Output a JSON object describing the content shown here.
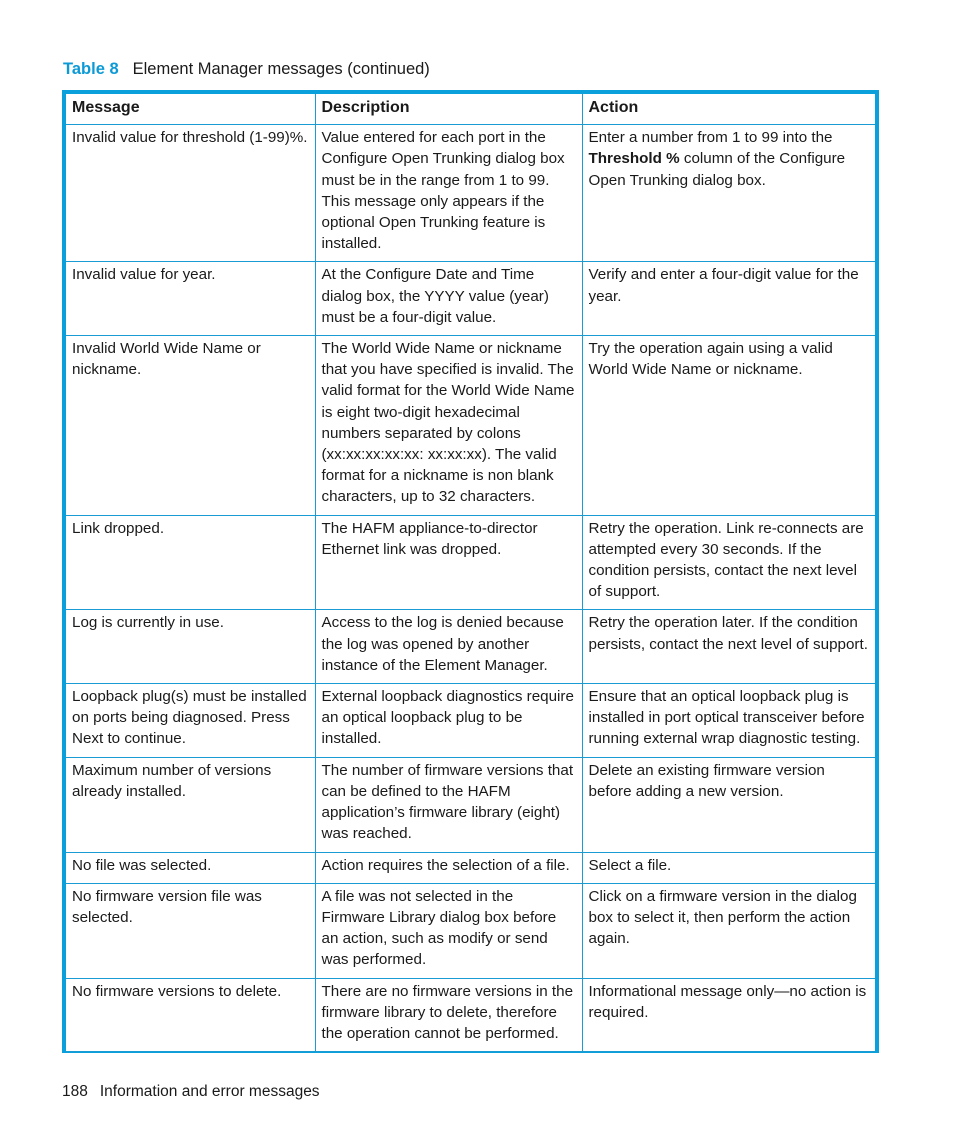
{
  "caption": {
    "table_number": "Table 8",
    "title": "Element Manager messages (continued)"
  },
  "table": {
    "headers": [
      "Message",
      "Description",
      "Action"
    ],
    "rows": [
      {
        "message": "Invalid value for threshold (1-99)%.",
        "description": "Value entered for each port in the Configure Open Trunking dialog box must be in the range from 1 to 99. This message only appears if the optional Open Trunking feature is installed.",
        "action_pre": "Enter a number from 1 to 99 into the ",
        "action_bold": "Threshold %",
        "action_post": " column of the Configure Open Trunking dialog box."
      },
      {
        "message": "Invalid value for year.",
        "description": "At the Configure Date and Time dialog box, the YYYY value (year) must be a four-digit value.",
        "action": "Verify and enter a four-digit value for the year."
      },
      {
        "message": "Invalid World Wide Name or nickname.",
        "description": "The World Wide Name or nickname that you have specified is invalid. The valid format for the World Wide Name is eight two-digit hexadecimal numbers separated by colons (xx:xx:xx:xx:xx: xx:xx:xx). The valid format for a nickname is non blank characters, up to 32 characters.",
        "action": "Try the operation again using a valid World Wide Name or nickname."
      },
      {
        "message": "Link dropped.",
        "description": "The HAFM appliance-to-director Ethernet link was dropped.",
        "action": "Retry the operation. Link re-connects are attempted every 30 seconds. If the condition persists, contact the next level of support."
      },
      {
        "message": "Log is currently in use.",
        "description": "Access to the log is denied because the log was opened by another instance of the Element Manager.",
        "action": "Retry the operation later. If the condition persists, contact the next level of support."
      },
      {
        "message": "Loopback plug(s) must be installed on ports being diagnosed. Press Next to continue.",
        "description": "External loopback diagnostics require an optical loopback plug to be installed.",
        "action": "Ensure that an optical loopback plug is installed in port optical transceiver before running external wrap diagnostic testing."
      },
      {
        "message": "Maximum number of versions already installed.",
        "description": "The number of firmware versions that can be defined to the HAFM application’s firmware library (eight) was reached.",
        "action": "Delete an existing firmware version before adding a new version."
      },
      {
        "message": "No file was selected.",
        "description": "Action requires the selection of a file.",
        "action": "Select a file."
      },
      {
        "message": "No firmware version file was selected.",
        "description": "A file was not selected in the Firmware Library dialog box before an action, such as modify or send was performed.",
        "action": "Click on a firmware version in the dialog box to select it, then perform the action again."
      },
      {
        "message": "No firmware versions to delete.",
        "description": "There are no firmware versions in the firmware library to delete, therefore the operation cannot be performed.",
        "action": "Informational message only—no action is required."
      }
    ]
  },
  "footer": {
    "page_number": "188",
    "section": "Information and error messages"
  },
  "colors": {
    "accent": "#0aa0dc",
    "rule": "#1a9bd4",
    "text": "#1a1a1a"
  }
}
